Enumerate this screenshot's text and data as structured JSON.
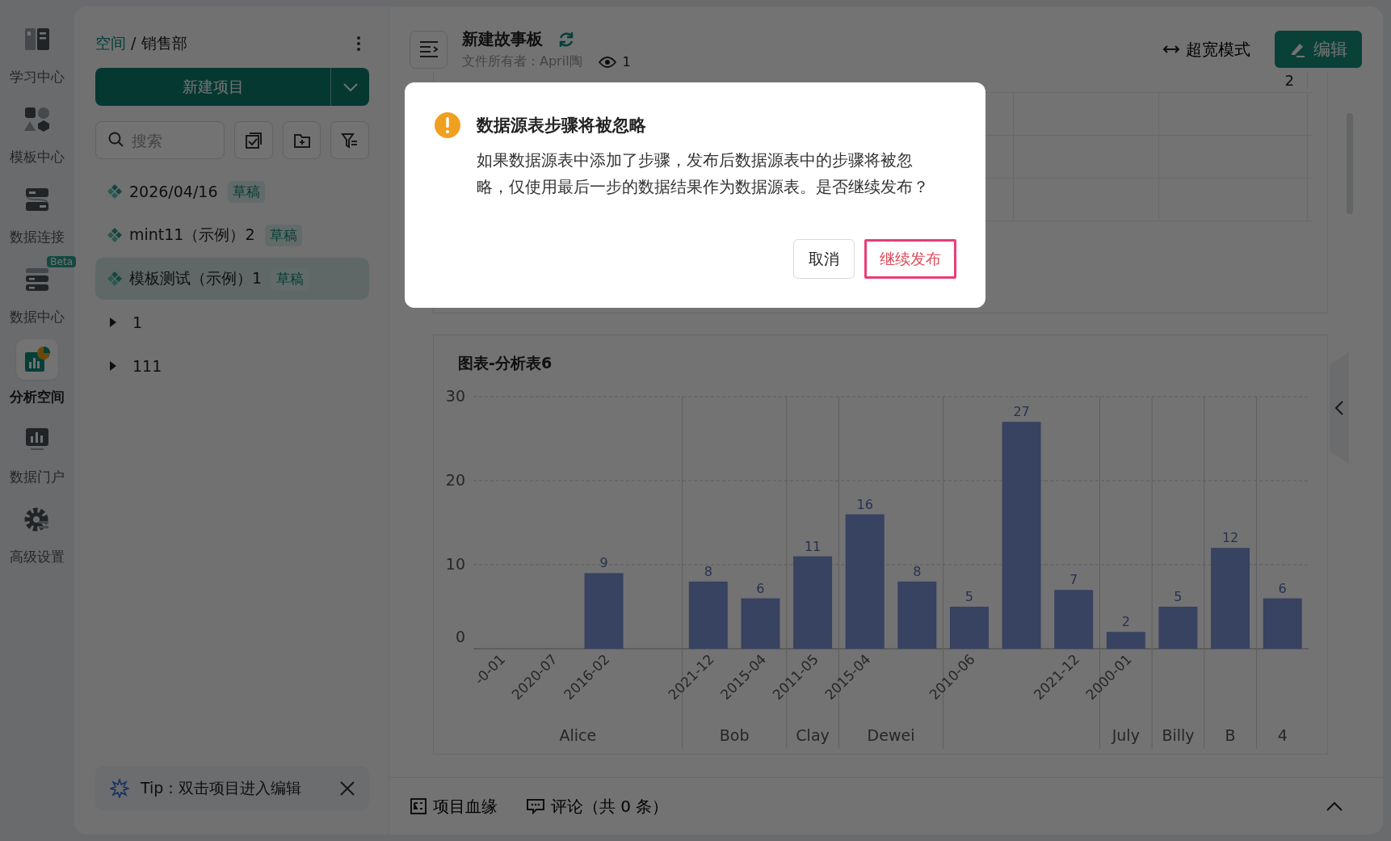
{
  "nav": [
    {
      "label": "学习中心",
      "selected": false
    },
    {
      "label": "模板中心",
      "selected": false
    },
    {
      "label": "数据连接",
      "selected": false
    },
    {
      "label": "数据中心",
      "selected": false,
      "badge": "Beta"
    },
    {
      "label": "分析空间",
      "selected": true
    },
    {
      "label": "数据门户",
      "selected": false
    },
    {
      "label": "高级设置",
      "selected": false
    }
  ],
  "sidebar": {
    "breadcrumb": {
      "link": "空间",
      "separator": "/",
      "current": "销售部"
    },
    "new_button": "新建项目",
    "search": {
      "placeholder": "搜索"
    },
    "items": [
      {
        "kind": "project",
        "label": "2026/04/16",
        "tag": "草稿",
        "selected": false
      },
      {
        "kind": "project",
        "label": "mint11（示例）2",
        "tag": "草稿",
        "selected": false
      },
      {
        "kind": "project",
        "label": "模板测试（示例）1",
        "tag": "草稿",
        "selected": true
      },
      {
        "kind": "folder",
        "label": "1",
        "expanded": false,
        "selected": false
      },
      {
        "kind": "folder",
        "label": "111",
        "expanded": false,
        "selected": false
      }
    ],
    "tip": "Tip：双击项目进入编辑"
  },
  "header": {
    "title": "新建故事板",
    "owner": "文件所有者：April陶",
    "views": "1",
    "wide_mode": "超宽模式",
    "edit_button": "编辑"
  },
  "table": {
    "row": [
      "2"
    ]
  },
  "chart_card": {
    "title": "图表-分析表6",
    "x_groups": [
      "Alice",
      "Bob",
      "Clay",
      "Dewei",
      "July",
      "Billy",
      "B",
      "4"
    ],
    "chart_data": {
      "type": "bar",
      "categories": [
        "-0-01",
        "2020-07",
        "2016-02",
        null,
        "2021-12",
        "2015-04",
        "2011-05",
        "2015-04",
        null,
        "2010-06",
        null,
        "2021-12",
        "2000-01",
        null,
        null,
        null
      ],
      "series": [
        {
          "color": "#7d93d8",
          "values": [
            null,
            null,
            9,
            null,
            8,
            6,
            11,
            16,
            8,
            5,
            27,
            7,
            2,
            5,
            12,
            6
          ]
        }
      ],
      "ylim": [
        0,
        30
      ],
      "yticks": [
        0,
        10,
        20,
        30
      ],
      "data_labels": true
    }
  },
  "bottom_bar": {
    "lineage": "项目血缘",
    "comments": "评论（共 0 条）"
  },
  "dialog": {
    "title": "数据源表步骤将被忽略",
    "message": "如果数据源表中添加了步骤，发布后数据源表中的步骤将被忽略，仅使用最后一步的数据结果作为数据源表。是否继续发布？",
    "buttons": [
      {
        "label": "取消",
        "kind": "default",
        "focused": false
      },
      {
        "label": "继续发布",
        "kind": "danger",
        "focused": true
      }
    ]
  }
}
